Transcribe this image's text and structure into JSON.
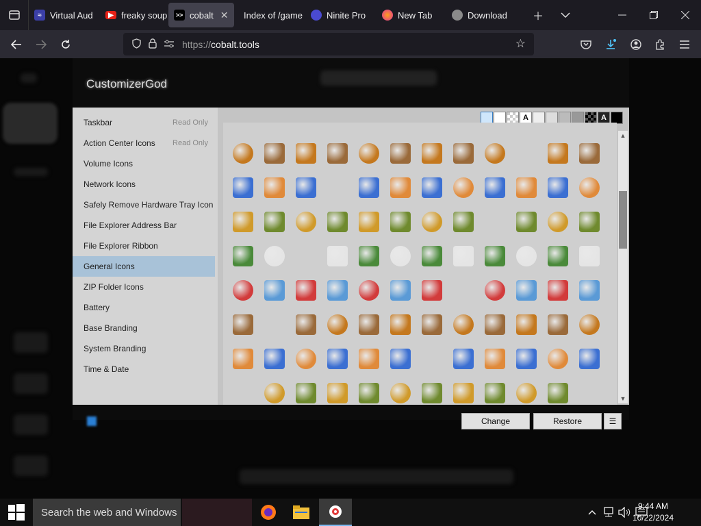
{
  "browser": {
    "tabs": [
      {
        "label": "Virtual Aud",
        "icon": "audio-favicon"
      },
      {
        "label": "freaky soup",
        "icon": "youtube-favicon"
      },
      {
        "label": "cobalt",
        "icon": "cobalt-favicon",
        "close": "✕"
      },
      {
        "label": "Index of /game",
        "icon": "blank-favicon"
      },
      {
        "label": "Ninite Pro",
        "icon": "ninite-favicon"
      },
      {
        "label": "New Tab",
        "icon": "firefox-favicon"
      },
      {
        "label": "Download",
        "icon": "download-favicon"
      }
    ],
    "url_scheme": "https://",
    "url_host": "cobalt.tools"
  },
  "customizer": {
    "title": "CustomizerGod",
    "categories": [
      {
        "label": "Taskbar",
        "badge": "Read Only"
      },
      {
        "label": "Action Center Icons",
        "badge": "Read Only"
      },
      {
        "label": "Volume Icons",
        "badge": ""
      },
      {
        "label": "Network Icons",
        "badge": ""
      },
      {
        "label": "Safely Remove Hardware Tray Icon",
        "badge": ""
      },
      {
        "label": "File Explorer Address Bar",
        "badge": ""
      },
      {
        "label": "File Explorer Ribbon",
        "badge": ""
      },
      {
        "label": "General Icons",
        "badge": ""
      },
      {
        "label": "ZIP Folder Icons",
        "badge": ""
      },
      {
        "label": "Battery",
        "badge": ""
      },
      {
        "label": "Base Branding",
        "badge": ""
      },
      {
        "label": "System Branding",
        "badge": ""
      },
      {
        "label": "Time & Date",
        "badge": ""
      }
    ],
    "selected_category": "General Icons",
    "swatch_letter": "A",
    "change_label": "Change",
    "restore_label": "Restore",
    "menu_label": "☰"
  },
  "taskbar": {
    "search_placeholder": "Search the web and Windows",
    "time": "9:44 AM",
    "date": "10/22/2024"
  }
}
